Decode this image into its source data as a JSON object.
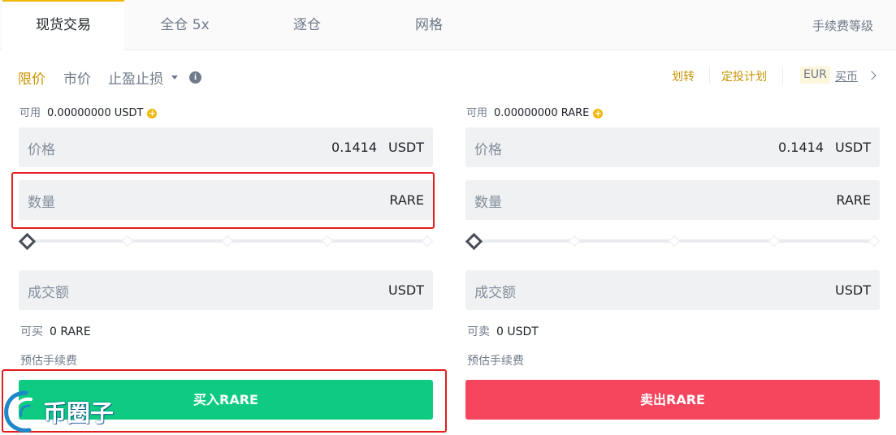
{
  "tabs": [
    {
      "label": "现货交易",
      "active": true
    },
    {
      "label": "全仓 5x",
      "active": false
    },
    {
      "label": "逐仓",
      "active": false
    },
    {
      "label": "网格",
      "active": false
    }
  ],
  "fee_level": "手续费等级",
  "order_types": {
    "limit": "限价",
    "market": "市价",
    "stop": "止盈止损",
    "active": "limit"
  },
  "top_links": {
    "transfer": "划转",
    "plan": "定投计划",
    "currency": "EUR",
    "buy_coin": "买币"
  },
  "buy": {
    "available_label": "可用",
    "available_value": "0.00000000 USDT",
    "price_label": "价格",
    "price_value": "0.1414",
    "price_unit": "USDT",
    "amount_label": "数量",
    "amount_value": "",
    "amount_unit": "RARE",
    "slider_percent": 0,
    "total_label": "成交额",
    "total_unit": "USDT",
    "can_trade_label": "可买",
    "can_trade_value": "0 RARE",
    "est_fee_label": "预估手续费",
    "button_label": "买入RARE"
  },
  "sell": {
    "available_label": "可用",
    "available_value": "0.00000000 RARE",
    "price_label": "价格",
    "price_value": "0.1414",
    "price_unit": "USDT",
    "amount_label": "数量",
    "amount_value": "",
    "amount_unit": "RARE",
    "slider_percent": 0,
    "total_label": "成交额",
    "total_unit": "USDT",
    "can_trade_label": "可卖",
    "can_trade_value": "0 USDT",
    "est_fee_label": "预估手续费",
    "button_label": "卖出RARE"
  },
  "watermark": {
    "text": "币圈子"
  },
  "colors": {
    "accent": "#f0b90b",
    "buy": "#0ecb81",
    "sell": "#f6465d",
    "highlight": "#e21d1d"
  }
}
